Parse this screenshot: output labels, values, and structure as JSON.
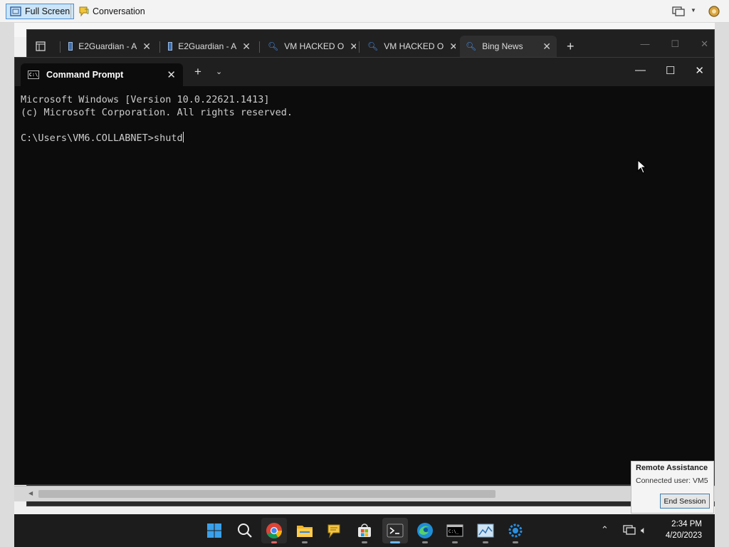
{
  "host_toolbar": {
    "fullscreen_label": "Full Screen",
    "conversation_label": "Conversation"
  },
  "browser": {
    "tabs": [
      {
        "label": "E2Guardian - A",
        "icon": "monitor-icon"
      },
      {
        "label": "E2Guardian - A",
        "icon": "monitor-icon"
      },
      {
        "label": "VM HACKED O",
        "icon": "bing-search-icon"
      },
      {
        "label": "VM HACKED O",
        "icon": "bing-search-icon"
      },
      {
        "label": "Bing News",
        "icon": "bing-search-icon",
        "active": true
      }
    ]
  },
  "terminal": {
    "tab_title": "Command Prompt",
    "lines": [
      "Microsoft Windows [Version 10.0.22621.1413]",
      "(c) Microsoft Corporation. All rights reserved.",
      "",
      "C:\\Users\\VM6.COLLABNET>shutd"
    ]
  },
  "remote_assistance": {
    "title": "Remote Assistance",
    "connected_user": "Connected user:  VM5",
    "end_session_label": "End Session"
  },
  "taskbar": {
    "apps": [
      "windows-start",
      "search",
      "chrome",
      "file-explorer",
      "sticky-chat",
      "microsoft-store",
      "terminal",
      "edge",
      "cmd",
      "performance-monitor",
      "config-tool"
    ],
    "active_app": "terminal",
    "time": "2:34 PM",
    "date": "4/20/2023"
  },
  "colors": {
    "terminal_bg": "#0c0c0c",
    "taskbar_bg": "#1c1c1c",
    "accent": "#6cb8f0"
  }
}
